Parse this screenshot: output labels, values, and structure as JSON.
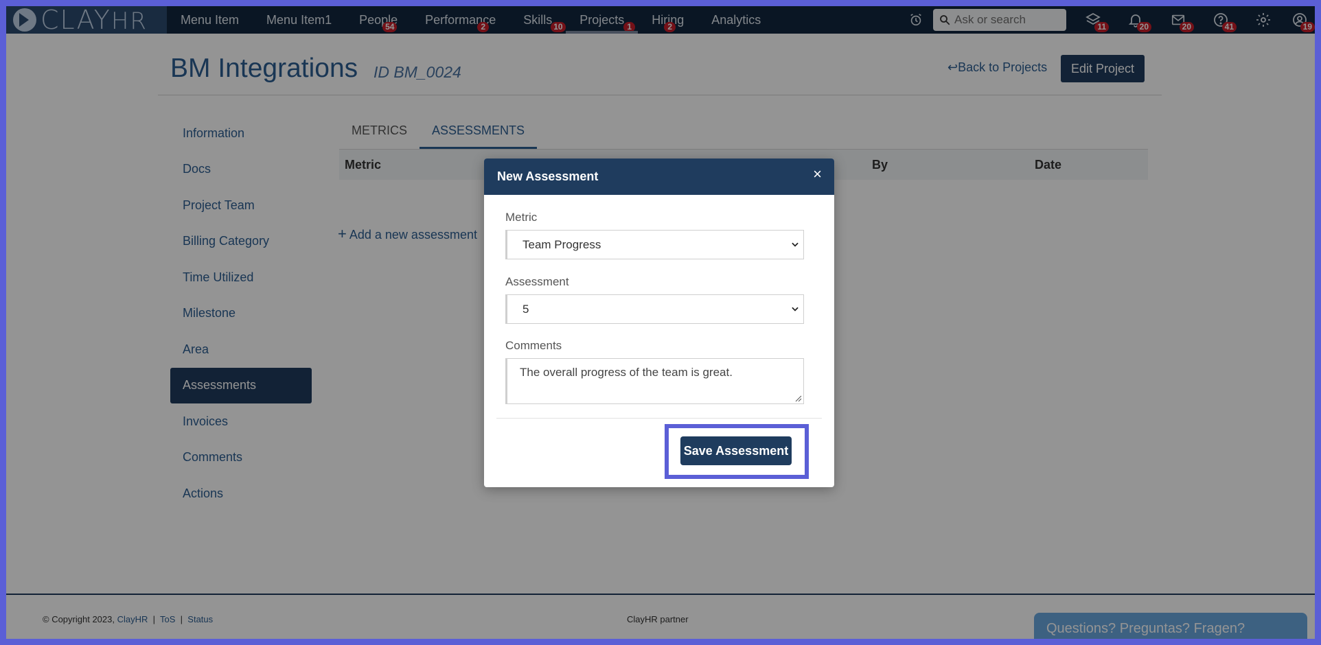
{
  "logo": {
    "text": "CLAY",
    "suffix": "HR"
  },
  "nav": [
    {
      "label": "Menu Item",
      "badge": ""
    },
    {
      "label": "Menu Item1",
      "badge": ""
    },
    {
      "label": "People",
      "badge": "54"
    },
    {
      "label": "Performance",
      "badge": "2"
    },
    {
      "label": "Skills",
      "badge": "10"
    },
    {
      "label": "Projects",
      "badge": "1",
      "active": true
    },
    {
      "label": "Hiring",
      "badge": "2"
    },
    {
      "label": "Analytics",
      "badge": ""
    }
  ],
  "search": {
    "placeholder": "Ask or search"
  },
  "header_icons": [
    {
      "icon": "stack-icon",
      "badge": "11"
    },
    {
      "icon": "bell-icon",
      "badge": "20"
    },
    {
      "icon": "mail-icon",
      "badge": "20"
    },
    {
      "icon": "help-icon",
      "badge": "41"
    },
    {
      "icon": "gear-icon",
      "badge": ""
    },
    {
      "icon": "user-profile-icon",
      "badge": "19"
    }
  ],
  "page": {
    "title": "BM Integrations",
    "id_text": "ID BM_0024",
    "back_link": "Back to Projects",
    "edit_button": "Edit Project"
  },
  "sidenav": [
    "Information",
    "Docs",
    "Project Team",
    "Billing Category",
    "Time Utilized",
    "Milestone",
    "Area",
    "Assessments",
    "Invoices",
    "Comments",
    "Actions"
  ],
  "sidenav_active": "Assessments",
  "tabs": [
    {
      "label": "METRICS"
    },
    {
      "label": "ASSESSMENTS",
      "active": true
    }
  ],
  "table": {
    "columns": [
      "Metric",
      "By",
      "Date"
    ]
  },
  "add_link": "Add a new assessment",
  "modal": {
    "title": "New Assessment",
    "close": "×",
    "metric_label": "Metric",
    "metric_value": "Team Progress",
    "assessment_label": "Assessment",
    "assessment_value": "5",
    "comments_label": "Comments",
    "comments_value": "The overall progress of the team is great.",
    "save_button": "Save Assessment"
  },
  "footer": {
    "copyright": "© Copyright 2023,",
    "brand_link": "ClayHR",
    "tos": "ToS",
    "status": "Status",
    "separator": "|",
    "center": "ClayHR partner",
    "chat": "Questions? Preguntas? Fragen?"
  },
  "colors": {
    "nav_bg": "#12273f",
    "primary": "#1f3c5e",
    "link": "#2c5d92",
    "badge": "#c81e2a",
    "highlight": "#5b5fd6"
  }
}
